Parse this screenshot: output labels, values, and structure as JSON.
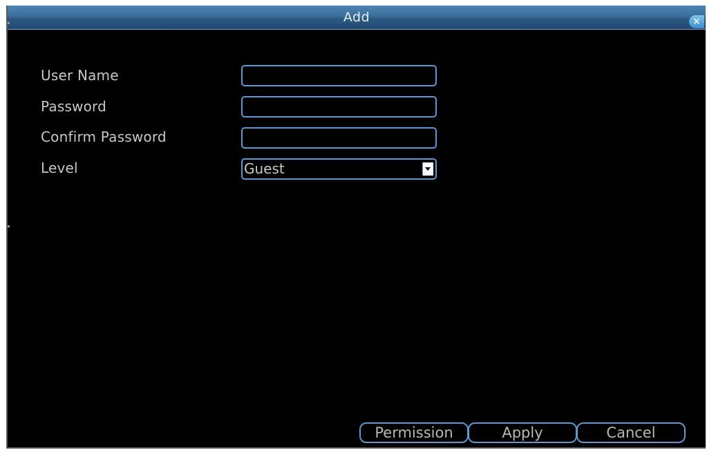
{
  "dialog": {
    "title": "Add",
    "close_label": "×"
  },
  "form": {
    "username_label": "User Name",
    "username_value": "",
    "password_label": "Password",
    "password_value": "",
    "confirm_label": "Confirm Password",
    "confirm_value": "",
    "level_label": "Level",
    "level_value": "Guest"
  },
  "buttons": {
    "permission": "Permission",
    "apply": "Apply",
    "cancel": "Cancel"
  },
  "colors": {
    "accent": "#5c9ad3",
    "titlebar": "#3a6e9b",
    "background": "#000000",
    "text": "#c8c8c8"
  }
}
